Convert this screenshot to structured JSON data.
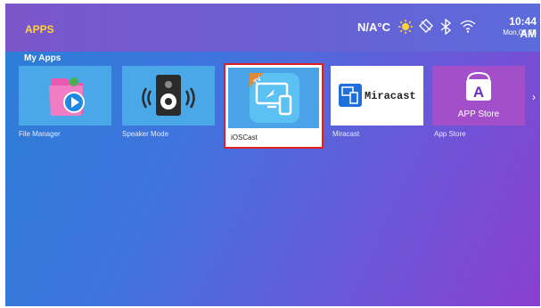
{
  "header": {
    "title": "APPS",
    "temperature": "N/A°C",
    "time": "10:44 AM",
    "date": "Mon,08.05"
  },
  "section_title": "My Apps",
  "apps": [
    {
      "label": "File Manager"
    },
    {
      "label": "Speaker Mode"
    },
    {
      "label": "iOSCast",
      "badge": "TV"
    },
    {
      "label": "Miracast",
      "logo_text": "Miracast"
    },
    {
      "label": "App Store",
      "logo_text": "APP Store"
    }
  ],
  "colors": {
    "focus_border": "#e0201f",
    "title": "#ffd23a"
  }
}
